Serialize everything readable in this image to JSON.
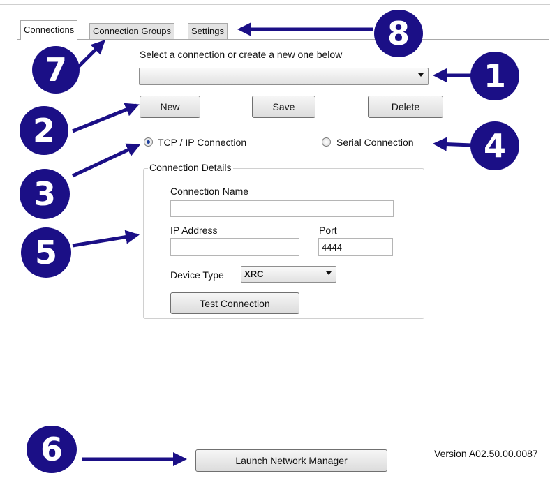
{
  "tabs": [
    {
      "label": "Connections"
    },
    {
      "label": "Connection Groups"
    },
    {
      "label": "Settings"
    }
  ],
  "main": {
    "select_prompt": "Select a connection or create a new one below",
    "connection_dropdown_value": "",
    "buttons": {
      "new": "New",
      "save": "Save",
      "delete": "Delete"
    },
    "radios": {
      "tcp": "TCP / IP Connection",
      "serial": "Serial Connection",
      "selected": "tcp"
    },
    "details": {
      "group_title": "Connection Details",
      "name_label": "Connection Name",
      "name_value": "",
      "ip_label": "IP Address",
      "ip_value": "",
      "port_label": "Port",
      "port_value": "4444",
      "device_type_label": "Device Type",
      "device_type_value": "XRC",
      "test_button": "Test Connection"
    }
  },
  "footer": {
    "launch_button": "Launch Network Manager",
    "version": "Version A02.50.00.0087"
  },
  "callouts": [
    "1",
    "2",
    "3",
    "4",
    "5",
    "6",
    "7",
    "8"
  ],
  "colors": {
    "callout": "#1b0f86"
  }
}
